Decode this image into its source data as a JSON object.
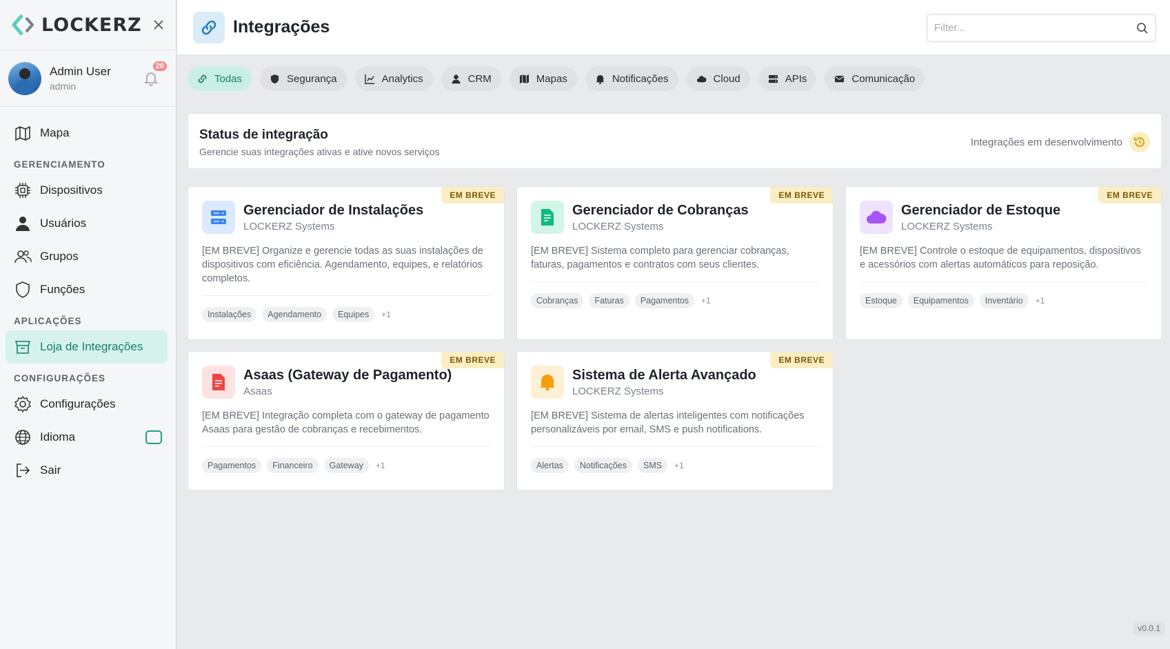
{
  "brand": {
    "name": "LOCKERZ"
  },
  "user": {
    "name": "Admin User",
    "role": "admin",
    "notifications": "20"
  },
  "nav": {
    "map": "Mapa",
    "section_management": "GERENCIAMENTO",
    "devices": "Dispositivos",
    "users": "Usuários",
    "groups": "Grupos",
    "roles": "Funções",
    "section_apps": "APLICAÇÕES",
    "store": "Loja de Integrações",
    "section_settings": "CONFIGURAÇÕES",
    "settings": "Configurações",
    "language": "Idioma",
    "logout": "Sair"
  },
  "header": {
    "title": "Integrações",
    "filter_placeholder": "Filter..."
  },
  "tabs": [
    "Todas",
    "Segurança",
    "Analytics",
    "CRM",
    "Mapas",
    "Notificações",
    "Cloud",
    "APIs",
    "Comunicação"
  ],
  "status": {
    "title": "Status de integração",
    "subtitle": "Gerencie suas integrações ativas e ative novos serviços",
    "right_label": "Integrações em desenvolvimento"
  },
  "badge_label": "EM BREVE",
  "cards": [
    {
      "title": "Gerenciador de Instalações",
      "vendor": "LOCKERZ Systems",
      "description": "[EM BREVE] Organize e gerencie todas as suas instalações de dispositivos com eficiência. Agendamento, equipes, e relatórios completos.",
      "tags": [
        "Instalações",
        "Agendamento",
        "Equipes"
      ],
      "more": "+1",
      "icon": "server-icon",
      "icon_color": "#3b82f6",
      "icon_bg": "#dbeafe"
    },
    {
      "title": "Gerenciador de Cobranças",
      "vendor": "LOCKERZ Systems",
      "description": "[EM BREVE] Sistema completo para gerenciar cobranças, faturas, pagamentos e contratos com seus clientes.",
      "tags": [
        "Cobranças",
        "Faturas",
        "Pagamentos"
      ],
      "more": "+1",
      "icon": "invoice-icon",
      "icon_color": "#10b981",
      "icon_bg": "#d1f5e6"
    },
    {
      "title": "Gerenciador de Estoque",
      "vendor": "LOCKERZ Systems",
      "description": "[EM BREVE] Controle o estoque de equipamentos, dispositivos e acessórios com alertas automáticos para reposição.",
      "tags": [
        "Estoque",
        "Equipamentos",
        "Inventário"
      ],
      "more": "+1",
      "icon": "cloud-icon",
      "icon_color": "#a855f7",
      "icon_bg": "#efe3fd"
    },
    {
      "title": "Asaas (Gateway de Pagamento)",
      "vendor": "Asaas",
      "description": "[EM BREVE] Integração completa com o gateway de pagamento Asaas para gestão de cobranças e recebimentos.",
      "tags": [
        "Pagamentos",
        "Financeiro",
        "Gateway"
      ],
      "more": "+1",
      "icon": "document-icon",
      "icon_color": "#ef4444",
      "icon_bg": "#fde2e2"
    },
    {
      "title": "Sistema de Alerta Avançado",
      "vendor": "LOCKERZ Systems",
      "description": "[EM BREVE] Sistema de alertas inteligentes com notificações personalizáveis por email, SMS e push notifications.",
      "tags": [
        "Alertas",
        "Notificações",
        "SMS"
      ],
      "more": "+1",
      "icon": "bell-icon",
      "icon_color": "#f59e0b",
      "icon_bg": "#fdf0d5"
    }
  ],
  "version": "v0.0.1"
}
